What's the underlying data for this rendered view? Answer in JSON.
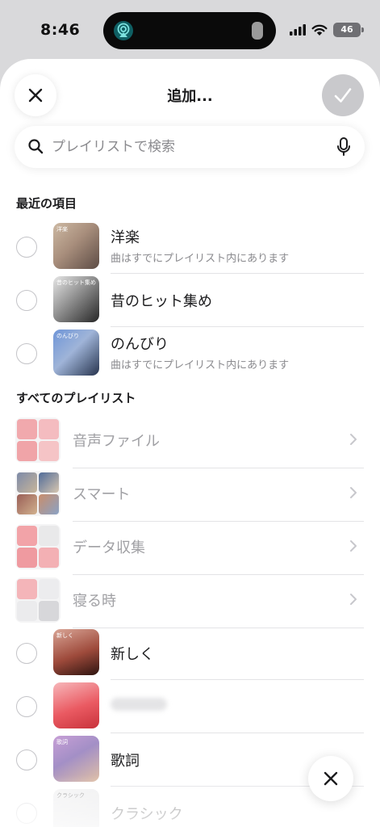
{
  "status_bar": {
    "time": "8:46",
    "battery": "46",
    "icons": [
      "airplay-audio-icon",
      "cellular-signal-icon",
      "wifi-icon",
      "battery-icon"
    ]
  },
  "header": {
    "title": "追加...",
    "close_icon": "close-icon",
    "done_icon": "checkmark-icon"
  },
  "search": {
    "placeholder": "プレイリストで検索",
    "value": "",
    "icon": "search-icon",
    "mic_icon": "microphone-icon"
  },
  "recent": {
    "title": "最近の項目",
    "items": [
      {
        "name": "洋楽",
        "thumb_label": "洋楽",
        "subtitle": "曲はすでにプレイリスト内にあります"
      },
      {
        "name": "昔のヒット集め",
        "thumb_label": "昔のヒット集め",
        "subtitle": ""
      },
      {
        "name": "のんびり",
        "thumb_label": "のんびり",
        "subtitle": "曲はすでにプレイリスト内にあります"
      }
    ]
  },
  "all_playlists": {
    "title": "すべてのプレイリスト",
    "folders": [
      {
        "name": "音声ファイル"
      },
      {
        "name": "スマート"
      },
      {
        "name": "データ収集"
      },
      {
        "name": "寝る時"
      }
    ],
    "items": [
      {
        "name": "新しく",
        "thumb_label": "新しく"
      },
      {
        "name": "",
        "thumb_label": ""
      },
      {
        "name": "歌詞",
        "thumb_label": "歌詞"
      },
      {
        "name": "クラシック",
        "thumb_label": "クラシック"
      }
    ]
  },
  "floating": {
    "icon": "close-icon"
  },
  "colors": {
    "background": "#d9d9db",
    "sheet": "#ffffff",
    "done_button": "#c9c9cc",
    "secondary_text": "#8a8a8e"
  }
}
